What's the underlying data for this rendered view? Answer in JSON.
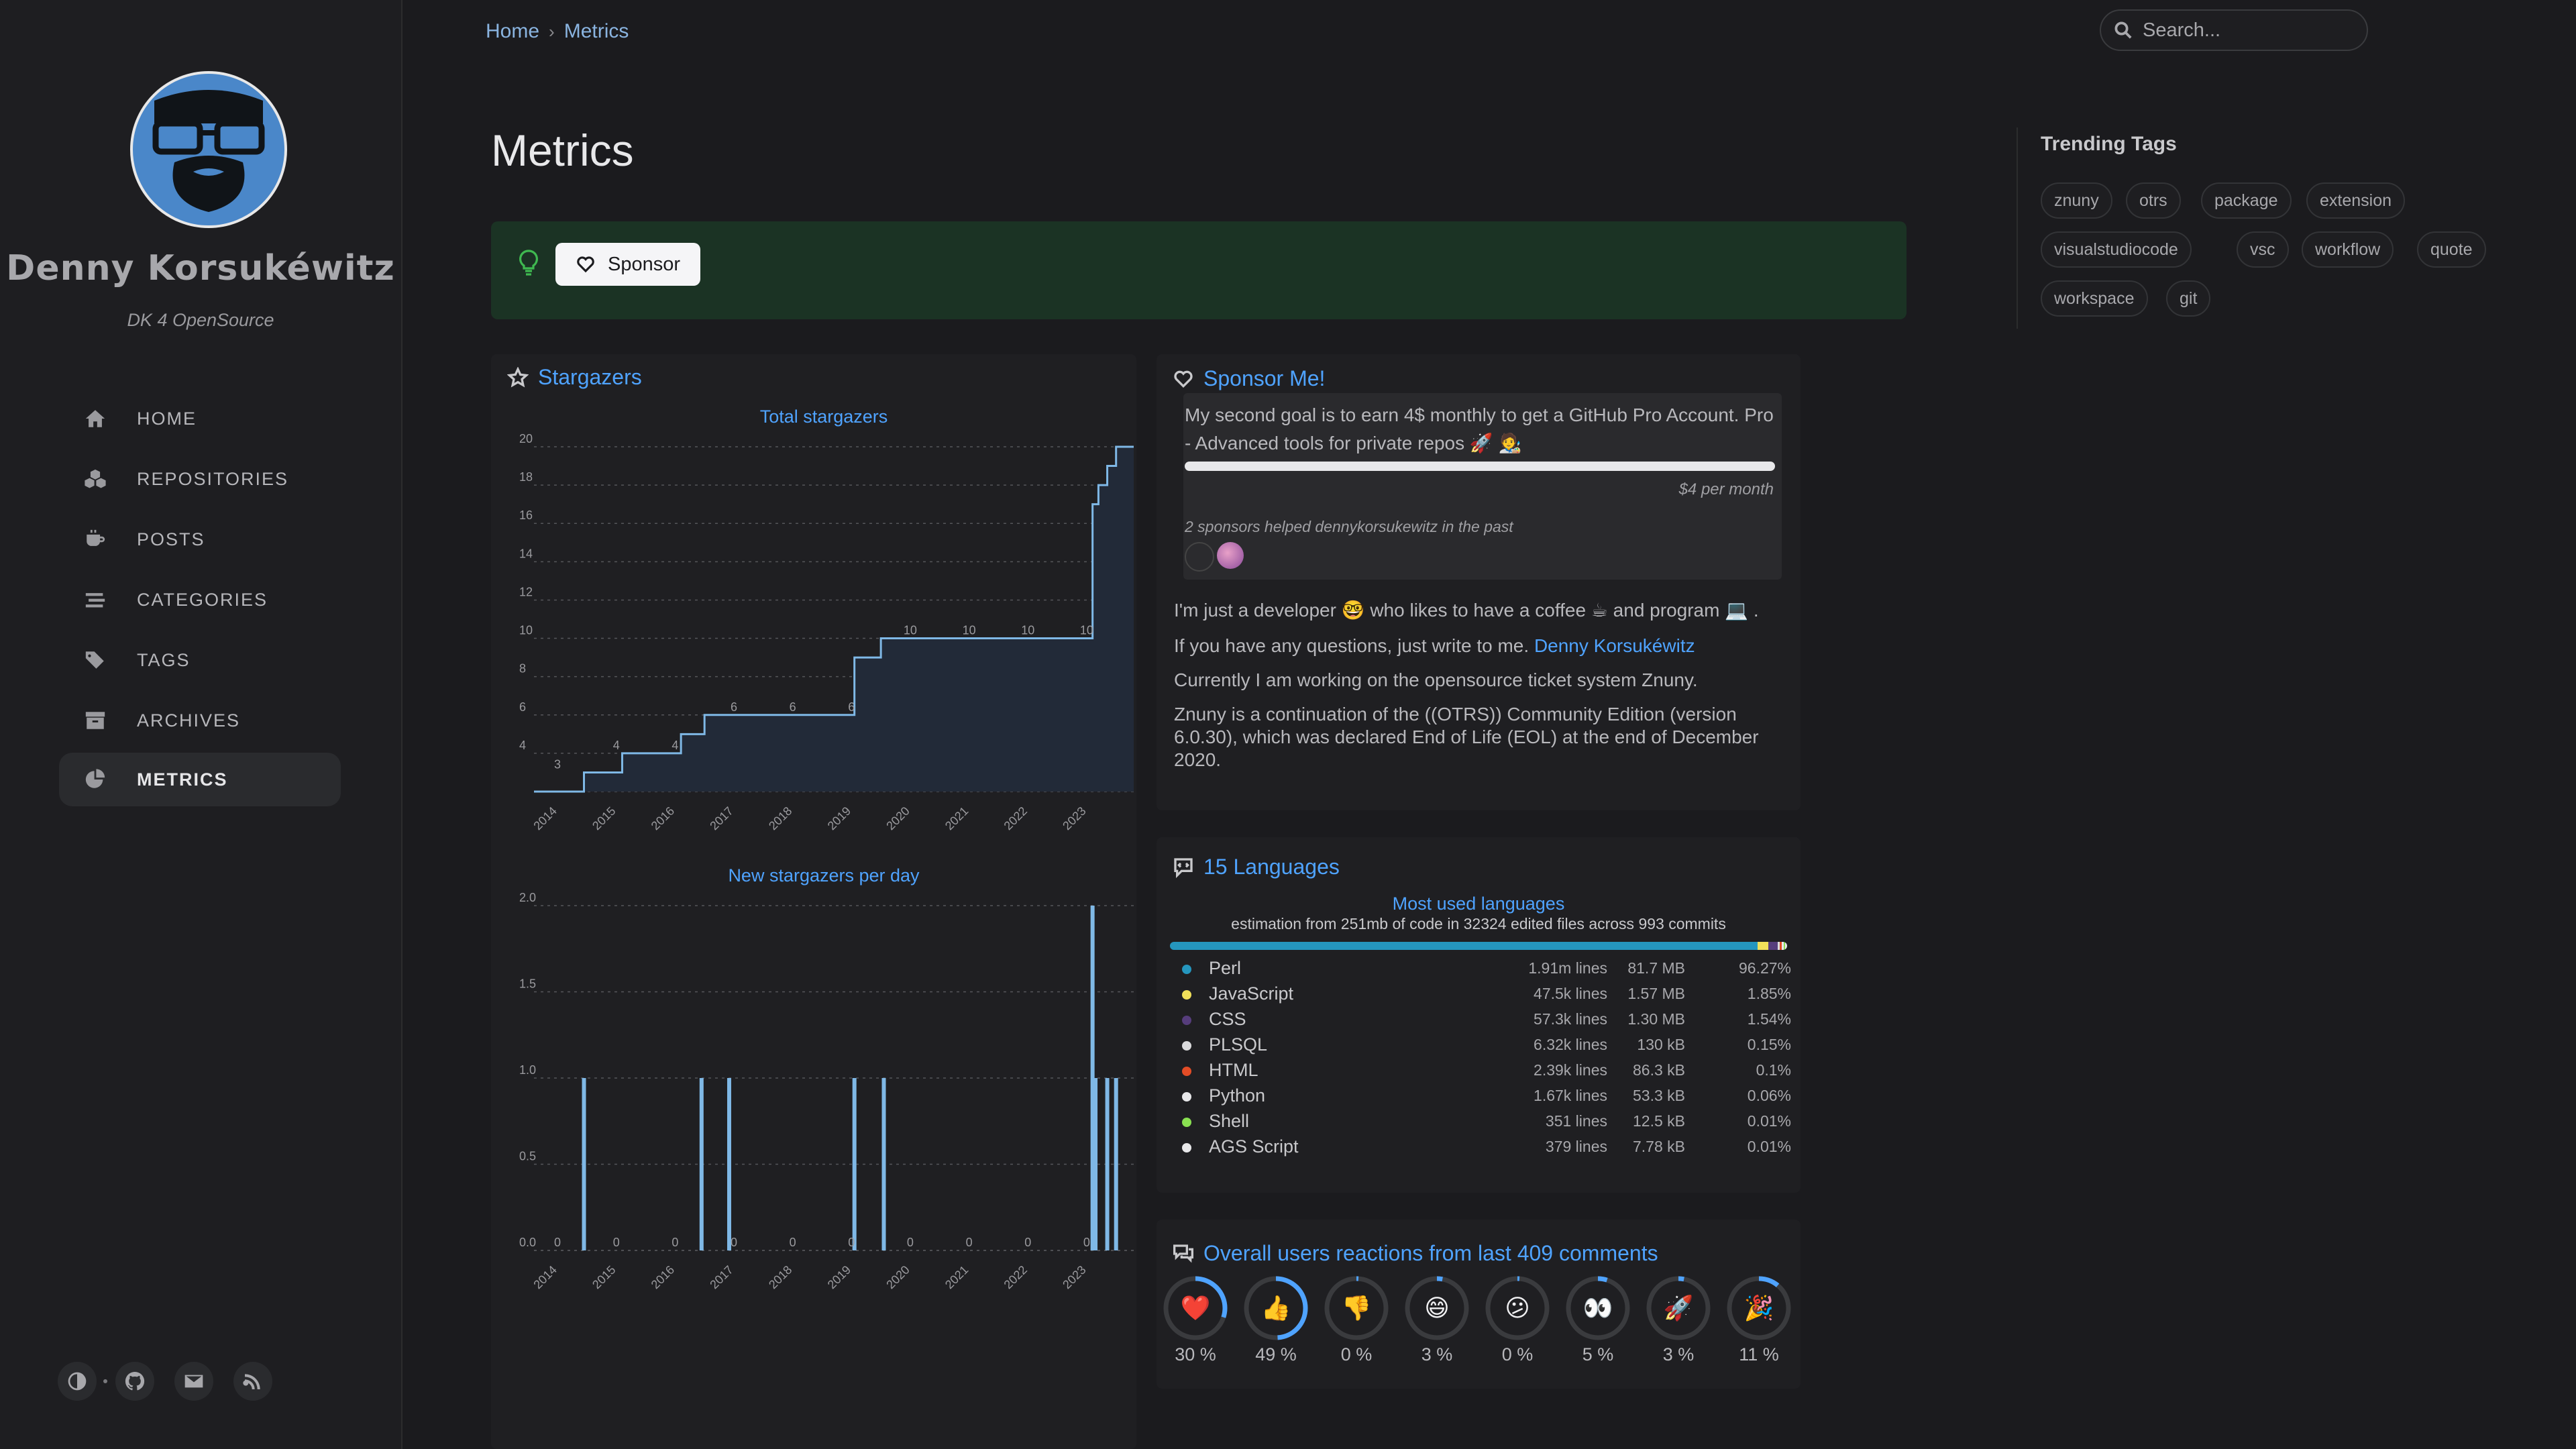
{
  "sidebar": {
    "site_title": "Denny Korsukéwitz",
    "site_subtitle": "DK 4 OpenSource",
    "nav": [
      {
        "label": "HOME",
        "icon": "home-icon"
      },
      {
        "label": "REPOSITORIES",
        "icon": "cubes-icon"
      },
      {
        "label": "POSTS",
        "icon": "coffee-icon"
      },
      {
        "label": "CATEGORIES",
        "icon": "stream-icon"
      },
      {
        "label": "TAGS",
        "icon": "tags-icon"
      },
      {
        "label": "ARCHIVES",
        "icon": "archive-icon"
      },
      {
        "label": "METRICS",
        "icon": "chart-pie-icon"
      }
    ],
    "active_nav": "METRICS",
    "footer_icons": [
      "theme-toggle-icon",
      "github-icon",
      "email-icon",
      "rss-icon"
    ]
  },
  "topbar": {
    "breadcrumb": [
      "Home",
      "Metrics"
    ],
    "search_placeholder": "Search..."
  },
  "page": {
    "title": "Metrics",
    "sponsor_button": "Sponsor"
  },
  "stargazers": {
    "heading": "Stargazers",
    "chart_total_title": "Total stargazers",
    "chart_new_title": "New stargazers per day"
  },
  "sponsor_me": {
    "heading": "Sponsor Me!",
    "goal_text": "My second goal is to earn 4$ monthly to get a GitHub Pro Account. Pro - Advanced tools for private repos 🚀 🧑‍🎨",
    "goal_progress": 1.0,
    "goal_amount": "$4 per month",
    "past_sponsors": "2 sponsors helped dennykorsukewitz in the past",
    "bio_1": "I'm just a developer 🤓  who likes to have a coffee ☕ and program 💻 .",
    "bio_2_prefix": "If you have any questions, just write to me. ",
    "bio_2_link": "Denny Korsukéwitz",
    "bio_3": "Currently I am working on the opensource ticket system Znuny.",
    "bio_4": "Znuny is a continuation of the ((OTRS)) Community Edition (version 6.0.30), which was declared End of Life (EOL) at the end of December 2020."
  },
  "languages": {
    "heading": "15 Languages",
    "chart_title": "Most used languages",
    "subtitle": "estimation from 251mb of code in 32324 edited files across 993 commits",
    "rows": [
      {
        "name": "Perl",
        "lines": "1.91m lines",
        "size": "81.7 MB",
        "pct": "96.27%",
        "share": 96.27,
        "color": "#2596be"
      },
      {
        "name": "JavaScript",
        "lines": "47.5k lines",
        "size": "1.57 MB",
        "pct": "1.85%",
        "share": 1.85,
        "color": "#f1e05a"
      },
      {
        "name": "CSS",
        "lines": "57.3k lines",
        "size": "1.30 MB",
        "pct": "1.54%",
        "share": 1.54,
        "color": "#563d7c"
      },
      {
        "name": "PLSQL",
        "lines": "6.32k lines",
        "size": "130 kB",
        "pct": "0.15%",
        "share": 0.15,
        "color": "#dadadc"
      },
      {
        "name": "HTML",
        "lines": "2.39k lines",
        "size": "86.3 kB",
        "pct": "0.1%",
        "share": 0.1,
        "color": "#e34c26"
      },
      {
        "name": "Python",
        "lines": "1.67k lines",
        "size": "53.3 kB",
        "pct": "0.06%",
        "share": 0.06,
        "color": "#e8e8ea"
      },
      {
        "name": "Shell",
        "lines": "351 lines",
        "size": "12.5 kB",
        "pct": "0.01%",
        "share": 0.01,
        "color": "#89e051"
      },
      {
        "name": "AGS Script",
        "lines": "379 lines",
        "size": "7.78 kB",
        "pct": "0.01%",
        "share": 0.01,
        "color": "#e8e8ea"
      }
    ]
  },
  "reactions": {
    "heading": "Overall users reactions from last 409 comments",
    "items": [
      {
        "emoji": "❤️",
        "icon": "heart-reaction-icon",
        "pct": "30 %",
        "value": 30
      },
      {
        "emoji": "👍",
        "icon": "thumbs-up-reaction-icon",
        "pct": "49 %",
        "value": 49
      },
      {
        "emoji": "👎",
        "icon": "thumbs-down-reaction-icon",
        "pct": "0 %",
        "value": 0
      },
      {
        "emoji": "😄",
        "icon": "laugh-reaction-icon",
        "pct": "3 %",
        "value": 3
      },
      {
        "emoji": "😕",
        "icon": "confused-reaction-icon",
        "pct": "0 %",
        "value": 0
      },
      {
        "emoji": "👀",
        "icon": "eyes-reaction-icon",
        "pct": "5 %",
        "value": 5
      },
      {
        "emoji": "🚀",
        "icon": "rocket-reaction-icon",
        "pct": "3 %",
        "value": 3
      },
      {
        "emoji": "🎉",
        "icon": "hooray-reaction-icon",
        "pct": "11 %",
        "value": 11
      }
    ]
  },
  "trending": {
    "title": "Trending Tags",
    "tags": [
      "znuny",
      "otrs",
      "package",
      "extension",
      "visualstudiocode",
      "vsc",
      "workflow",
      "quote",
      "workspace",
      "git"
    ]
  },
  "colors": {
    "accent": "#4fa3ff",
    "chart_line": "#7fb8e6",
    "chart_fill": "#222a38",
    "background": "#1b1b1e",
    "sponsor_bar": "#1b3324"
  },
  "chart_data": [
    {
      "type": "line",
      "title": "Total stargazers",
      "x_ticks": [
        "2014",
        "2015",
        "2016",
        "2017",
        "2018",
        "2019",
        "2020",
        "2021",
        "2022",
        "2023"
      ],
      "y_ticks": [
        4,
        6,
        8,
        10,
        12,
        14,
        16,
        18,
        20
      ],
      "ylim": [
        2,
        20
      ],
      "xlim": [
        2013.6,
        2023.8
      ],
      "step": true,
      "series": [
        {
          "x": [
            2013.6,
            2014.45,
            2015.1,
            2015.8,
            2016.1,
            2016.5,
            2017.0,
            2018.0,
            2019.0,
            2019.05,
            2019.5,
            2020.0,
            2021.0,
            2022.0,
            2023.0,
            2023.1,
            2023.2,
            2023.35,
            2023.5,
            2023.8
          ],
          "y": [
            2,
            3,
            4,
            4,
            5,
            6,
            6,
            6,
            6,
            9,
            10,
            10,
            10,
            10,
            10,
            17,
            18,
            19,
            20,
            20
          ]
        }
      ],
      "data_labels": [
        {
          "x": 2014,
          "y": 3,
          "label": "3"
        },
        {
          "x": 2015,
          "y": 4,
          "label": "4"
        },
        {
          "x": 2016,
          "y": 4,
          "label": "4"
        },
        {
          "x": 2017,
          "y": 6,
          "label": "6"
        },
        {
          "x": 2018,
          "y": 6,
          "label": "6"
        },
        {
          "x": 2019,
          "y": 6,
          "label": "6"
        },
        {
          "x": 2020,
          "y": 10,
          "label": "10"
        },
        {
          "x": 2021,
          "y": 10,
          "label": "10"
        },
        {
          "x": 2022,
          "y": 10,
          "label": "10"
        },
        {
          "x": 2023,
          "y": 10,
          "label": "10"
        }
      ]
    },
    {
      "type": "bar",
      "title": "New stargazers per day",
      "x_ticks": [
        "2014",
        "2015",
        "2016",
        "2017",
        "2018",
        "2019",
        "2020",
        "2021",
        "2022",
        "2023"
      ],
      "y_ticks": [
        "0.0",
        "0.5",
        "1.0",
        "1.5",
        "2.0"
      ],
      "ylim": [
        0,
        2
      ],
      "xlim": [
        2013.6,
        2023.8
      ],
      "series": [
        {
          "x": [
            2014.45,
            2016.45,
            2016.92,
            2019.05,
            2019.55,
            2023.1,
            2023.15,
            2023.35,
            2023.5
          ],
          "y": [
            1,
            1,
            1,
            1,
            1,
            2,
            1,
            1,
            1
          ]
        }
      ],
      "data_labels": [
        {
          "x": 2014,
          "y": 0,
          "label": "0"
        },
        {
          "x": 2015,
          "y": 0,
          "label": "0"
        },
        {
          "x": 2016,
          "y": 0,
          "label": "0"
        },
        {
          "x": 2017,
          "y": 0,
          "label": "0"
        },
        {
          "x": 2018,
          "y": 0,
          "label": "0"
        },
        {
          "x": 2019,
          "y": 0,
          "label": "0"
        },
        {
          "x": 2020,
          "y": 0,
          "label": "0"
        },
        {
          "x": 2021,
          "y": 0,
          "label": "0"
        },
        {
          "x": 2022,
          "y": 0,
          "label": "0"
        },
        {
          "x": 2023,
          "y": 0,
          "label": "0"
        }
      ]
    }
  ]
}
